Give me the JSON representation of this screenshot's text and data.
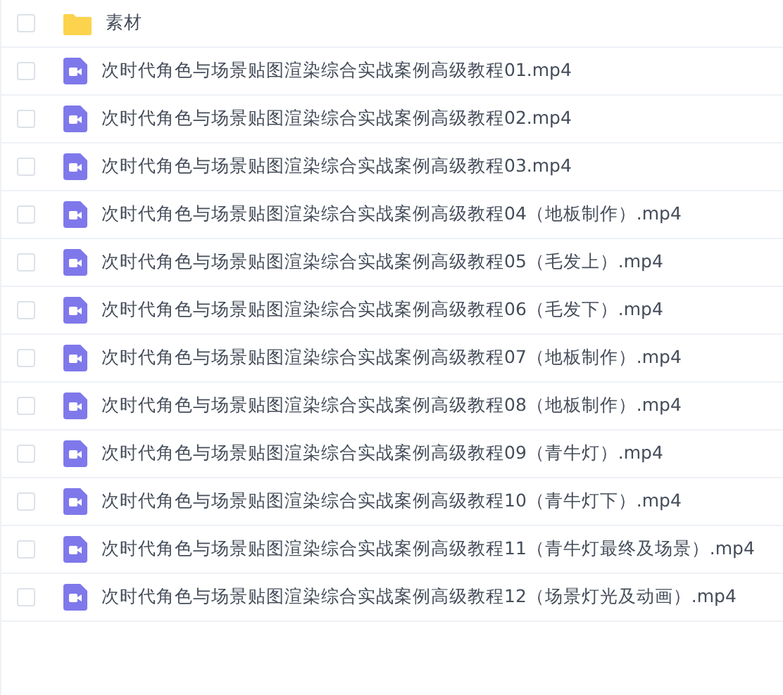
{
  "files": [
    {
      "kind": "folder",
      "name": "素材",
      "checked": false
    },
    {
      "kind": "video",
      "name": "次时代角色与场景贴图渲染综合实战案例高级教程01.mp4",
      "checked": false
    },
    {
      "kind": "video",
      "name": "次时代角色与场景贴图渲染综合实战案例高级教程02.mp4",
      "checked": false
    },
    {
      "kind": "video",
      "name": "次时代角色与场景贴图渲染综合实战案例高级教程03.mp4",
      "checked": false
    },
    {
      "kind": "video",
      "name": "次时代角色与场景贴图渲染综合实战案例高级教程04（地板制作）.mp4",
      "checked": false
    },
    {
      "kind": "video",
      "name": "次时代角色与场景贴图渲染综合实战案例高级教程05（毛发上）.mp4",
      "checked": false
    },
    {
      "kind": "video",
      "name": "次时代角色与场景贴图渲染综合实战案例高级教程06（毛发下）.mp4",
      "checked": false
    },
    {
      "kind": "video",
      "name": "次时代角色与场景贴图渲染综合实战案例高级教程07（地板制作）.mp4",
      "checked": false
    },
    {
      "kind": "video",
      "name": "次时代角色与场景贴图渲染综合实战案例高级教程08（地板制作）.mp4",
      "checked": false
    },
    {
      "kind": "video",
      "name": "次时代角色与场景贴图渲染综合实战案例高级教程09（青牛灯）.mp4",
      "checked": false
    },
    {
      "kind": "video",
      "name": "次时代角色与场景贴图渲染综合实战案例高级教程10（青牛灯下）.mp4",
      "checked": false
    },
    {
      "kind": "video",
      "name": "次时代角色与场景贴图渲染综合实战案例高级教程11（青牛灯最终及场景）.mp4",
      "checked": false
    },
    {
      "kind": "video",
      "name": "次时代角色与场景贴图渲染综合实战案例高级教程12（场景灯光及动画）.mp4",
      "checked": false
    }
  ]
}
